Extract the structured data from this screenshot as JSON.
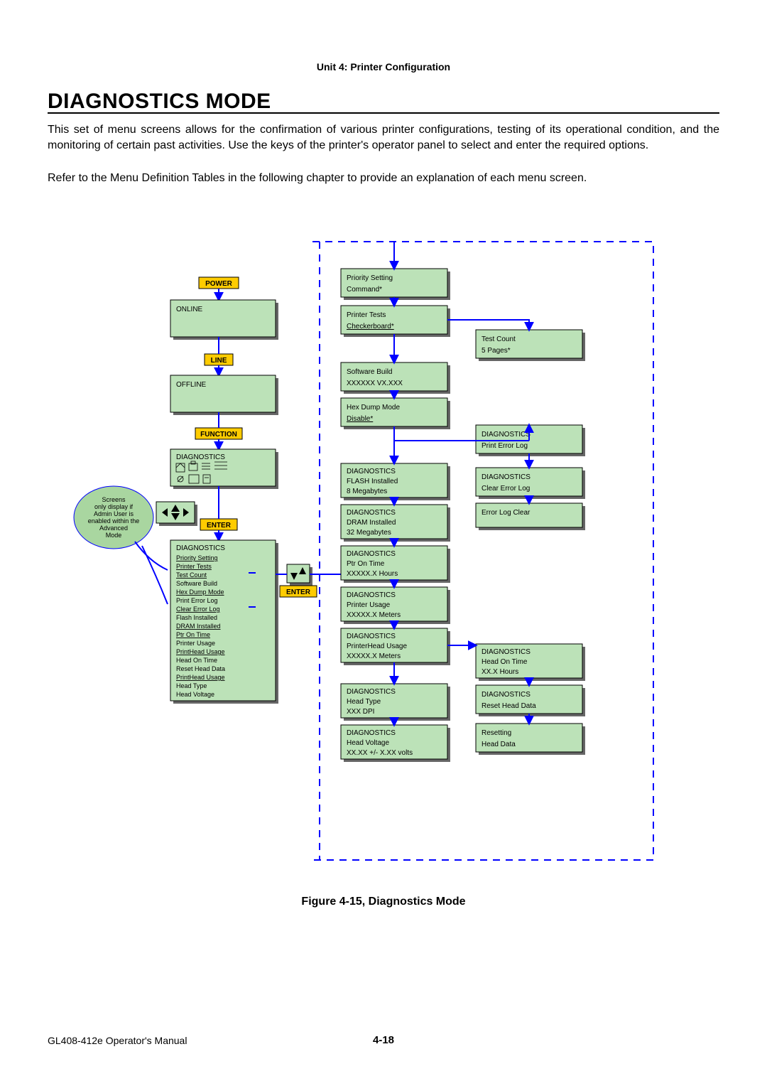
{
  "header": {
    "unit": "Unit 4: Printer Configuration"
  },
  "title": "DIAGNOSTICS MODE",
  "para1": "This set of menu screens allows for the confirmation of various printer configurations, testing of its operational condition, and the monitoring of certain past activities. Use the keys of the printer's operator panel to select and enter the required options.",
  "para2": "Refer to the Menu Definition Tables in the following chapter to provide an explanation of each menu screen.",
  "buttons": {
    "power": "POWER",
    "line": "LINE",
    "function": "FUNCTION",
    "enter1": "ENTER",
    "enter2": "ENTER"
  },
  "bubble": {
    "l1": "Screens",
    "l2": "only display if",
    "l3": "Admin User is",
    "l4": "enabled within the",
    "l5": "Advanced",
    "l6": "Mode"
  },
  "left": {
    "online": "ONLINE",
    "offline": "OFFLINE",
    "diagTitle": "DIAGNOSTICS",
    "menuTitle": "DIAGNOSTICS",
    "menu": {
      "i1": "Priority Setting",
      "i2": "Printer Tests",
      "i3": "Test Count",
      "i4": "Software Build",
      "i5": "Hex Dump Mode",
      "i6": "Print Error Log",
      "i7": "Clear Error Log",
      "i8": "Flash Installed",
      "i9": "DRAM Installed",
      "i10": "Ptr On Time",
      "i11": "Printer Usage",
      "i12": "PrintHead Usage",
      "i13": "Head On Time",
      "i14": "Reset Head Data",
      "i15": "PrintHead Usage",
      "i16": "Head Type",
      "i17": "Head Voltage"
    }
  },
  "col2": {
    "b1": {
      "l1": "Priority Setting",
      "l2": "Command*"
    },
    "b2": {
      "l1": "Printer Tests",
      "l2": "Checkerboard*"
    },
    "b3": {
      "l1": "Software Build",
      "l2": "XXXXXX  VX.XXX"
    },
    "b4": {
      "l1": "Hex Dump Mode",
      "l2": "Disable*"
    },
    "b5": {
      "l1": "DIAGNOSTICS",
      "l2": "FLASH Installed",
      "l3": "8 Megabytes"
    },
    "b6": {
      "l1": "DIAGNOSTICS",
      "l2": "DRAM Installed",
      "l3": "32 Megabytes"
    },
    "b7": {
      "l1": "DIAGNOSTICS",
      "l2": "Ptr On Time",
      "l3": "XXXXX.X  Hours"
    },
    "b8": {
      "l1": "DIAGNOSTICS",
      "l2": "Printer Usage",
      "l3": "XXXXX.X  Meters"
    },
    "b9": {
      "l1": "DIAGNOSTICS",
      "l2": "PrinterHead Usage",
      "l3": "XXXXX.X  Meters"
    },
    "b10": {
      "l1": "DIAGNOSTICS",
      "l2": "Head Type",
      "l3": "XXX   DPI"
    },
    "b11": {
      "l1": "DIAGNOSTICS",
      "l2": "Head Voltage",
      "l3": "XX.XX +/- X.XX  volts"
    }
  },
  "col3": {
    "b1": {
      "l1": "Test Count",
      "l2": "5  Pages*"
    },
    "b2": {
      "l1": "DIAGNOSTICS",
      "l2": "Print Error Log"
    },
    "b3": {
      "l1": "DIAGNOSTICS",
      "l2": "Clear Error Log"
    },
    "b4": {
      "l1": "Error Log Clear"
    },
    "b5": {
      "l1": "DIAGNOSTICS",
      "l2": "Head On Time",
      "l3": "XX.X Hours"
    },
    "b6": {
      "l1": "DIAGNOSTICS",
      "l2": "Reset Head Data"
    },
    "b7": {
      "l1": "Resetting",
      "l2": "Head Data"
    }
  },
  "caption": "Figure 4-15, Diagnostics Mode",
  "footer": {
    "left": "GL408-412e Operator's Manual",
    "center": "4-18"
  }
}
